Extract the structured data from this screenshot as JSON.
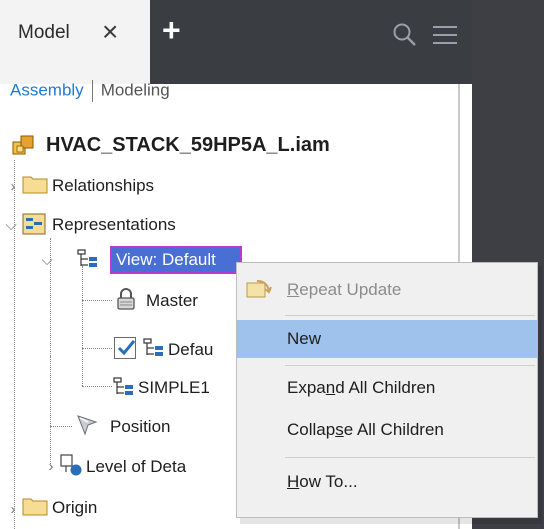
{
  "tabs": {
    "model_label": "Model",
    "close_glyph": "×",
    "add_glyph": "+"
  },
  "mode": {
    "assembly": "Assembly",
    "modeling": "Modeling"
  },
  "tree": {
    "root": "HVAC_STACK_59HP5A_L.iam",
    "relationships": "Relationships",
    "representations": "Representations",
    "view_default": "View: Default",
    "master": "Master",
    "default_partial": "Defau",
    "simple1": "SIMPLE1",
    "position": "Position",
    "level_of_detail_partial": "Level of Deta",
    "origin": "Origin"
  },
  "context_menu": {
    "repeat_update": {
      "pre": "",
      "accel": "R",
      "post": "epeat Update",
      "enabled": false
    },
    "new": {
      "label": "New",
      "highlighted": true
    },
    "expand_all": {
      "pre": "Expa",
      "accel": "n",
      "post": "d All Children"
    },
    "collapse_all": {
      "pre": "Collap",
      "accel": "s",
      "post": "e All Children"
    },
    "how_to": {
      "pre": "",
      "accel": "H",
      "post": "ow To..."
    }
  },
  "colors": {
    "header_dark": "#3a3d42",
    "assembly_blue": "#1f7bd1",
    "selection_blue": "#4a6fd4",
    "selection_border": "#b93ad0",
    "menu_highlight": "#9ec2ec",
    "folder_yellow": "#f3d27a"
  },
  "icons": {
    "close": "close-icon",
    "add": "plus-icon",
    "search": "search-icon",
    "menu": "hamburger-menu-icon",
    "assembly": "assembly-icon",
    "folder": "folder-icon",
    "representations": "representations-icon",
    "view": "view-representation-icon",
    "lock": "lock-icon",
    "checkbox": "checkbox-checked-icon",
    "position": "position-icon",
    "level_of_detail": "level-of-detail-icon",
    "repeat_update": "repeat-update-icon"
  }
}
